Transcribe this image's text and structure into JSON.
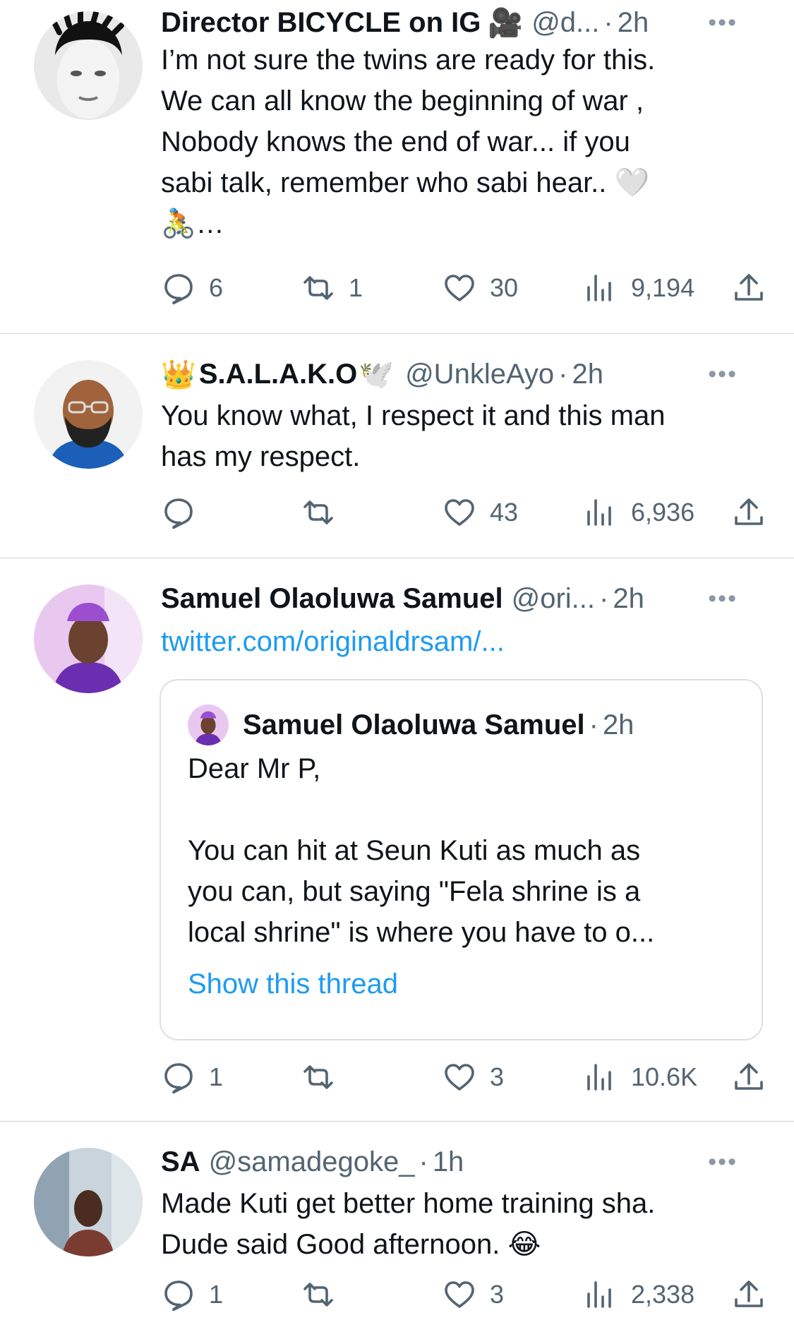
{
  "tweets": [
    {
      "name": "Director BICYCLE on IG",
      "name_emoji": "🎥",
      "handle": "@d...",
      "time": "2h",
      "more": "•••",
      "text_lines": [
        "I’m not sure the twins are ready for this.",
        "We can all know the beginning of war ,",
        "Nobody knows the end of war...  if you",
        "sabi talk, remember who sabi hear.. 🤍",
        "🚴…"
      ],
      "actions": {
        "replies": "6",
        "retweets": "1",
        "likes": "30",
        "views": "9,194"
      }
    },
    {
      "name_prefix_emoji": "👑",
      "name": "S.A.L.A.K.O",
      "name_emoji": "🕊️",
      "handle": "@UnkleAyo",
      "time": "2h",
      "more": "•••",
      "text_lines": [
        "You know what, I respect it and this man",
        "has my respect."
      ],
      "actions": {
        "replies": "",
        "retweets": "",
        "likes": "43",
        "views": "6,936"
      }
    },
    {
      "name": "Samuel Olaoluwa Samuel",
      "handle": "@ori...",
      "time": "2h",
      "more": "•••",
      "link": "twitter.com/originaldrsam/...",
      "quote": {
        "name": "Samuel Olaoluwa Samuel",
        "time": "2h",
        "text_lines": [
          "Dear Mr P,",
          "",
          "You can hit at Seun Kuti as much as",
          "you can, but saying \"Fela shrine is a",
          "local shrine\" is where you have to o..."
        ],
        "show_thread": "Show this thread"
      },
      "actions": {
        "replies": "1",
        "retweets": "",
        "likes": "3",
        "views": "10.6K"
      }
    },
    {
      "name": "SA",
      "handle": "@samadegoke_",
      "time": "1h",
      "more": "•••",
      "text_lines": [
        "Made Kuti get better home training sha.",
        "Dude said Good afternoon. 😂"
      ],
      "actions": {
        "replies": "1",
        "retweets": "",
        "likes": "3",
        "views": "2,338"
      }
    }
  ],
  "icons": {
    "reply": "reply-icon",
    "retweet": "retweet-icon",
    "like": "heart-icon",
    "views": "views-icon",
    "share": "share-icon"
  },
  "colors": {
    "link": "#1d9bf0",
    "muted": "#536471",
    "text": "#0f1419",
    "divider": "#d4d4d4"
  }
}
